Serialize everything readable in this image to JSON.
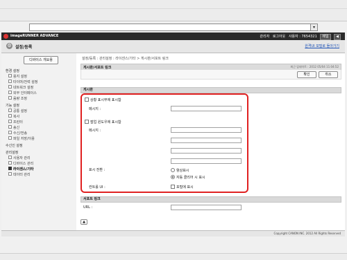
{
  "browser": {
    "address_dropdown_icon": "chevron-down-icon"
  },
  "header": {
    "brand": "imageRUNNER ADVANCE",
    "admin_label": "관리자",
    "logout_label": "로그아웃",
    "user_text": "사용자 : 7654321",
    "mail_label": "메일",
    "back_label": "◀"
  },
  "titlebar": {
    "icon_glyph": "⚙",
    "title": "설정/등록",
    "portal_link": "원격UI 포털로 돌아가기"
  },
  "sidebar": {
    "device_button": "디바이스 개요용",
    "groups": [
      {
        "title": "환경 설정",
        "items": [
          "용지 설정",
          "타이머/전력 설정",
          "네트워크 설정",
          "외부 인터페이스",
          "음량 조정"
        ]
      },
      {
        "title": "기능 설정",
        "items": [
          "공통 설정",
          "복사",
          "프린터",
          "송신",
          "수신/전송",
          "파일 저장/이용"
        ]
      },
      {
        "title": "수신인 설정",
        "items": []
      },
      {
        "title": "관리설정",
        "items": [
          "사용자 관리",
          "디바이스 관리",
          "라이센스/기타",
          "데이터 관리"
        ]
      }
    ]
  },
  "main": {
    "breadcrumb": "설정/등록 : 관리설정 : 라이센스/기타 > 게시판/서포트 링크",
    "panel_title": "게시판/서포트 링크",
    "last_updated": "최근 업데이트 : 2012 05/04 11:04:52",
    "ok_button": "확인",
    "cancel_button": "취소",
    "bulletin_section": "게시판",
    "status_display_label": "상황 표시부에 표시함",
    "message_label_1": "메시지 :",
    "popup_label": "팝업 윈도우에 표시함",
    "message_label_2": "메시지 :",
    "display_timing_label": "표시 전환 :",
    "always_show": "항상표시",
    "auto_close": "자동 클리어 시 표시",
    "control_ui_label": "컨트롤 UI :",
    "portal_display": "포털에 표시",
    "support_section": "서포트 링크",
    "url_label": "URL :",
    "scroll_top_icon": "arrow-up-icon"
  },
  "footer": {
    "copyright": "Copyright CANON INC. 2012 All Rights Reserved"
  }
}
